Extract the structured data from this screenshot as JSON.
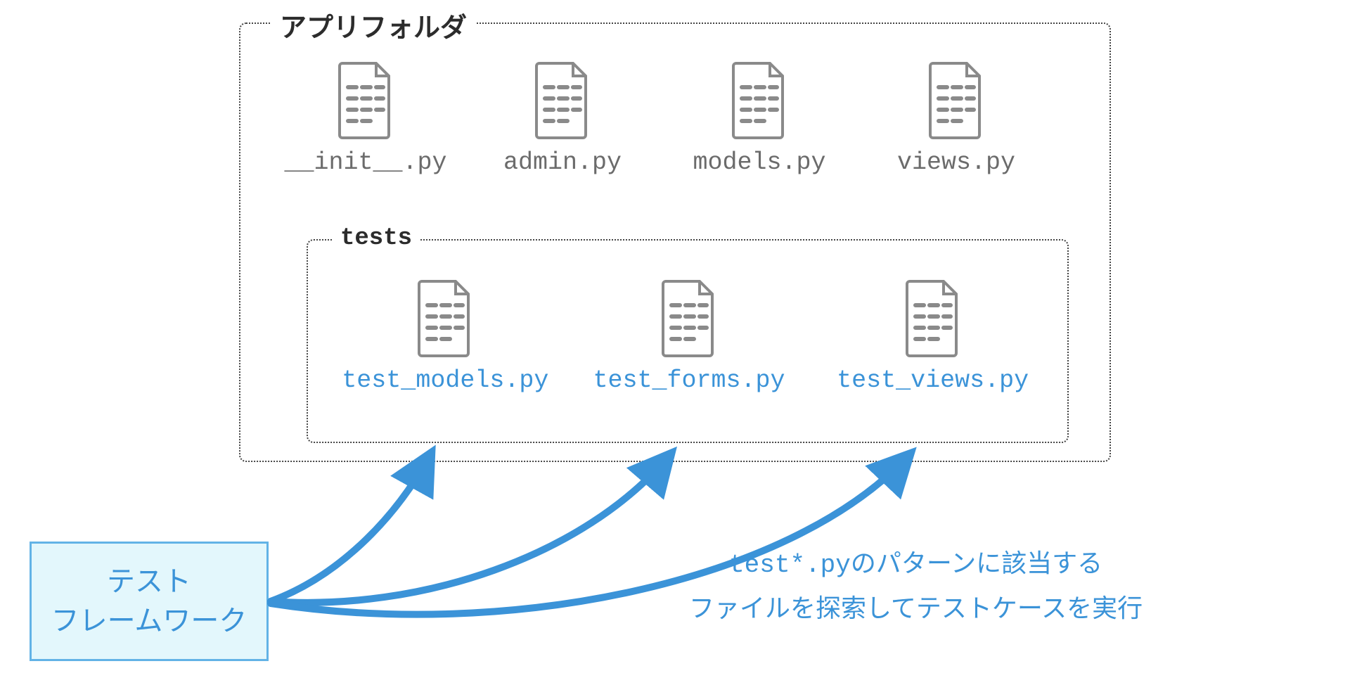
{
  "app_folder_label": "アプリフォルダ",
  "tests_label": "tests",
  "app_files": [
    "__init__.py",
    "admin.py",
    "models.py",
    "views.py"
  ],
  "test_files": [
    "test_models.py",
    "test_forms.py",
    "test_views.py"
  ],
  "framework_line1": "テスト",
  "framework_line2": "フレームワーク",
  "explain_line1": "test*.pyのパターンに該当する",
  "explain_line2": "ファイルを探索してテストケースを実行",
  "colors": {
    "accent_blue": "#3b93d8",
    "pale_blue": "#e3f7fc",
    "gray_text": "#6b6b6b",
    "border": "#444444"
  }
}
